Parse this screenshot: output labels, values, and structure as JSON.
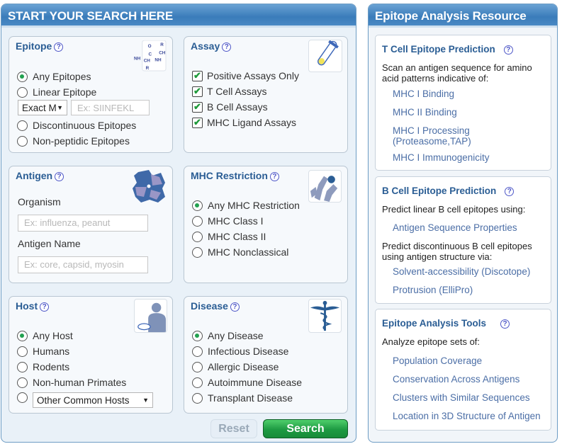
{
  "search_panel": {
    "title": "START YOUR SEARCH HERE",
    "epitope": {
      "title": "Epitope",
      "help": "?",
      "icon": "peptide-structure-icon",
      "options": [
        {
          "label": "Any Epitopes",
          "selected": true
        },
        {
          "label": "Linear Epitope",
          "selected": false
        },
        {
          "label": "Discontinuous Epitopes",
          "selected": false
        },
        {
          "label": "Non-peptidic Epitopes",
          "selected": false
        }
      ],
      "match_select": "Exact M",
      "sequence_placeholder": "Ex: SIINFEKL"
    },
    "assay": {
      "title": "Assay",
      "help": "?",
      "icon": "test-tube-icon",
      "options": [
        {
          "label": "Positive Assays Only",
          "checked": true
        },
        {
          "label": "T Cell Assays",
          "checked": true
        },
        {
          "label": "B Cell Assays",
          "checked": true
        },
        {
          "label": "MHC Ligand Assays",
          "checked": true
        }
      ]
    },
    "antigen": {
      "title": "Antigen",
      "help": "?",
      "icon": "protein-structure-icon",
      "organism_label": "Organism",
      "organism_placeholder": "Ex: influenza, peanut",
      "antigen_name_label": "Antigen Name",
      "antigen_name_placeholder": "Ex: core, capsid, myosin"
    },
    "mhc": {
      "title": "MHC Restriction",
      "help": "?",
      "icon": "mhc-molecule-icon",
      "options": [
        {
          "label": "Any MHC Restriction",
          "selected": true
        },
        {
          "label": "MHC Class I",
          "selected": false
        },
        {
          "label": "MHC Class II",
          "selected": false
        },
        {
          "label": "MHC Nonclassical",
          "selected": false
        }
      ]
    },
    "host": {
      "title": "Host",
      "help": "?",
      "icon": "host-person-mouse-icon",
      "options": [
        {
          "label": "Any Host",
          "selected": true
        },
        {
          "label": "Humans",
          "selected": false
        },
        {
          "label": "Rodents",
          "selected": false
        },
        {
          "label": "Non-human Primates",
          "selected": false
        }
      ],
      "other_select": "Other Common Hosts"
    },
    "disease": {
      "title": "Disease",
      "help": "?",
      "icon": "caduceus-icon",
      "options": [
        {
          "label": "Any Disease",
          "selected": true
        },
        {
          "label": "Infectious Disease",
          "selected": false
        },
        {
          "label": "Allergic Disease",
          "selected": false
        },
        {
          "label": "Autoimmune Disease",
          "selected": false
        },
        {
          "label": "Transplant Disease",
          "selected": false
        }
      ]
    },
    "reset_label": "Reset",
    "search_label": "Search"
  },
  "resource_panel": {
    "title": "Epitope Analysis Resource",
    "tcell": {
      "title": "T Cell Epitope Prediction",
      "help": "?",
      "description": "Scan an antigen sequence for amino acid patterns indicative of:",
      "links": [
        "MHC I Binding",
        "MHC II Binding",
        "MHC I Processing (Proteasome,TAP)",
        "MHC I Immunogenicity"
      ]
    },
    "bcell": {
      "title": "B Cell Epitope Prediction",
      "help": "?",
      "linear_description": "Predict linear B cell epitopes using:",
      "linear_links": [
        "Antigen Sequence Properties"
      ],
      "discontinuous_description": "Predict discontinuous B cell epitopes using antigen structure via:",
      "discontinuous_links": [
        "Solvent-accessibility (Discotope)",
        "Protrusion (ElliPro)"
      ]
    },
    "tools": {
      "title": "Epitope Analysis Tools",
      "help": "?",
      "description": "Analyze epitope sets of:",
      "links": [
        "Population Coverage",
        "Conservation Across Antigens",
        "Clusters with Similar Sequences",
        "Location in 3D Structure of Antigen"
      ]
    }
  }
}
